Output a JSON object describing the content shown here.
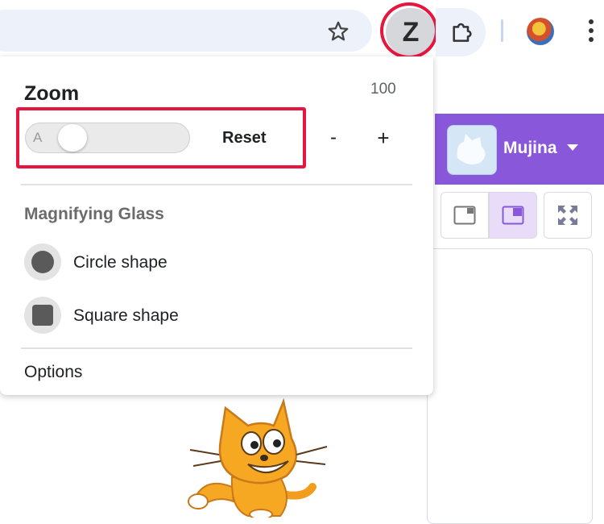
{
  "toolbar": {
    "zoom_extension_letter": "Z",
    "icons": [
      "star-icon",
      "puzzle-icon",
      "profile-avatar",
      "more-vert-icon"
    ]
  },
  "scratch": {
    "username": "Mujina"
  },
  "zoom_popup": {
    "title": "Zoom",
    "zoom_value": "100",
    "slider_label": "A",
    "reset_label": "Reset",
    "minus_label": "-",
    "plus_label": "+",
    "magnifying_title": "Magnifying Glass",
    "shapes": [
      {
        "label": "Circle shape",
        "icon": "circle-shape-icon"
      },
      {
        "label": "Square shape",
        "icon": "square-shape-icon"
      }
    ],
    "options_label": "Options"
  },
  "colors": {
    "highlight": "#e6163f",
    "scratch_purple": "#8957d9",
    "omnibox": "#edf2fa"
  }
}
